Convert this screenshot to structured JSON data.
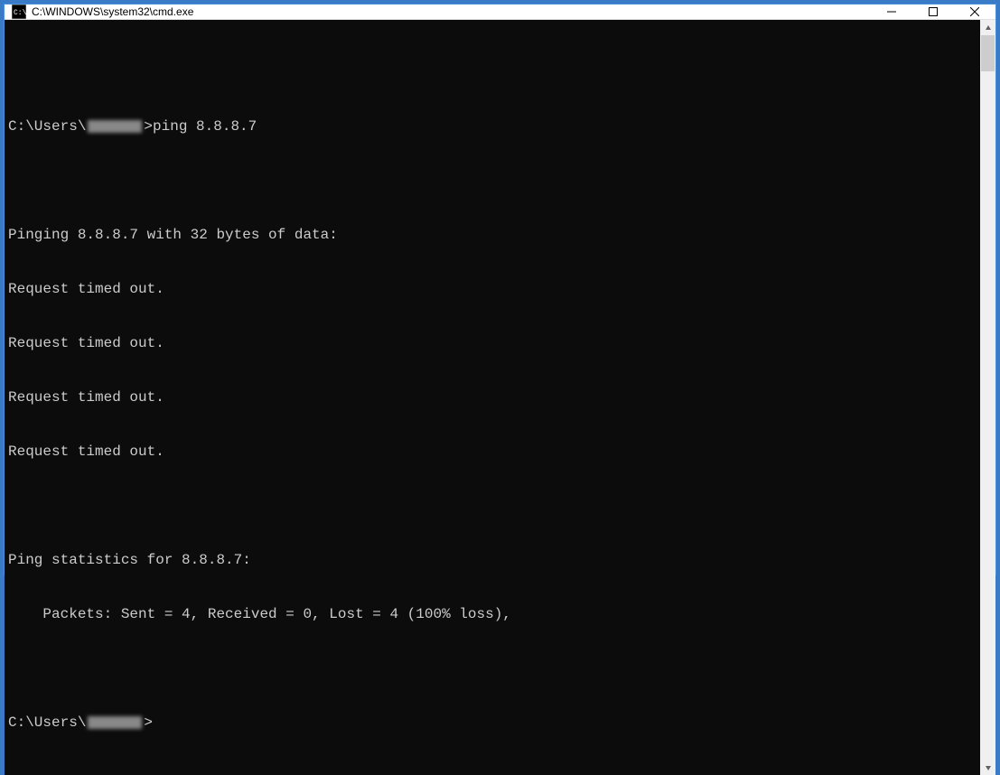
{
  "titlebar": {
    "title": "C:\\WINDOWS\\system32\\cmd.exe"
  },
  "terminal": {
    "prompt_path": "C:\\Users\\",
    "prompt_suffix": ">",
    "command": "ping 8.8.8.7",
    "output": {
      "header": "Pinging 8.8.8.7 with 32 bytes of data:",
      "timeout1": "Request timed out.",
      "timeout2": "Request timed out.",
      "timeout3": "Request timed out.",
      "timeout4": "Request timed out.",
      "stats_header": "Ping statistics for 8.8.8.7:",
      "stats_packets": "    Packets: Sent = 4, Received = 0, Lost = 4 (100% loss),"
    }
  }
}
